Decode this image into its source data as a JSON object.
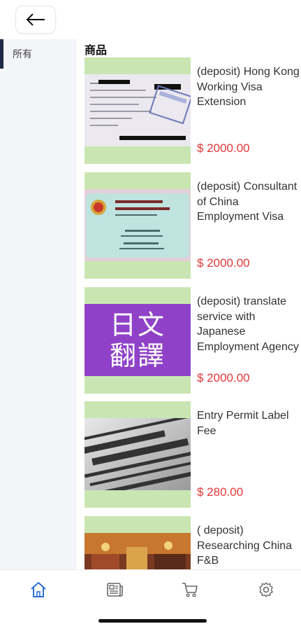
{
  "header": {
    "back_icon": "arrow-left-icon"
  },
  "sidebar": {
    "categories": [
      {
        "label": "所有",
        "selected": true
      }
    ]
  },
  "main": {
    "section_title": "商品",
    "products": [
      {
        "name": "(deposit) Hong Kong Working Visa Extension",
        "price": "$ 2000.00",
        "image": "visa-stamp-photo"
      },
      {
        "name": "(deposit) Consultant of China Employment Visa",
        "price": "$ 2000.00",
        "image": "china-work-permit-card"
      },
      {
        "name": "(deposit) translate service with Japanese Employment Agency",
        "price": "$ 2000.00",
        "image": "japanese-translation-banner",
        "image_text_line1": "日文",
        "image_text_line2": "翻譯"
      },
      {
        "name": "Entry Permit Label Fee",
        "price": "$ 280.00",
        "image": "entry-permit-newsprint"
      },
      {
        "name": "( deposit) Researching China F&B",
        "price": "",
        "image": "restaurant-photo"
      }
    ]
  },
  "tabbar": {
    "tabs": [
      {
        "icon": "home-icon",
        "active": true
      },
      {
        "icon": "news-icon",
        "active": false
      },
      {
        "icon": "cart-icon",
        "active": false
      },
      {
        "icon": "gear-icon",
        "active": false
      }
    ]
  },
  "colors": {
    "accent": "#2f6fd6",
    "price": "#e2373a",
    "thumb_bg": "#c9e6b2",
    "sidebar_bg": "#f4f5f8",
    "sidebar_indicator": "#1f2a44"
  }
}
